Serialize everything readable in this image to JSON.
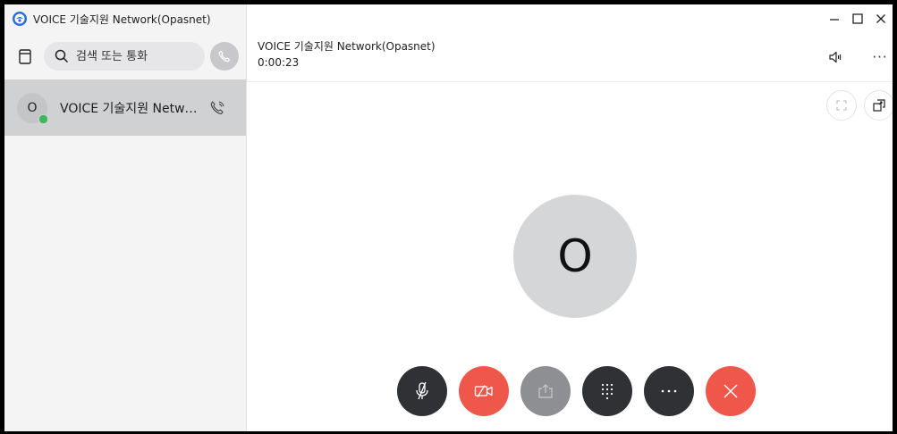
{
  "app": {
    "window_title": "VOICE 기술지원 Network(Opasnet)"
  },
  "sidebar": {
    "search": {
      "placeholder": "검색 또는 통화",
      "value": ""
    },
    "conversations": [
      {
        "initial": "O",
        "label": "VOICE 기술지원 Network(Opasnet)",
        "status": "online"
      }
    ]
  },
  "call": {
    "name": "VOICE 기술지원 Network(Opasnet)",
    "timer": "0:00:23",
    "avatar_initial": "O"
  },
  "window_controls": {
    "minimize": "−",
    "maximize": "☐",
    "close": "✕"
  },
  "top_actions": {
    "more": "···"
  },
  "colors": {
    "accent_red": "#f0574b",
    "dark_button": "#2f3134",
    "disabled_button": "#8e8f92",
    "presence_online": "#3cb85e",
    "selected_item": "#d0d1d3"
  },
  "icons": {
    "mute": "microphone-slash-icon",
    "video": "video-off-icon",
    "share": "share-screen-icon",
    "keypad": "keypad-icon",
    "more": "more-icon",
    "hangup": "hang-up-icon"
  }
}
